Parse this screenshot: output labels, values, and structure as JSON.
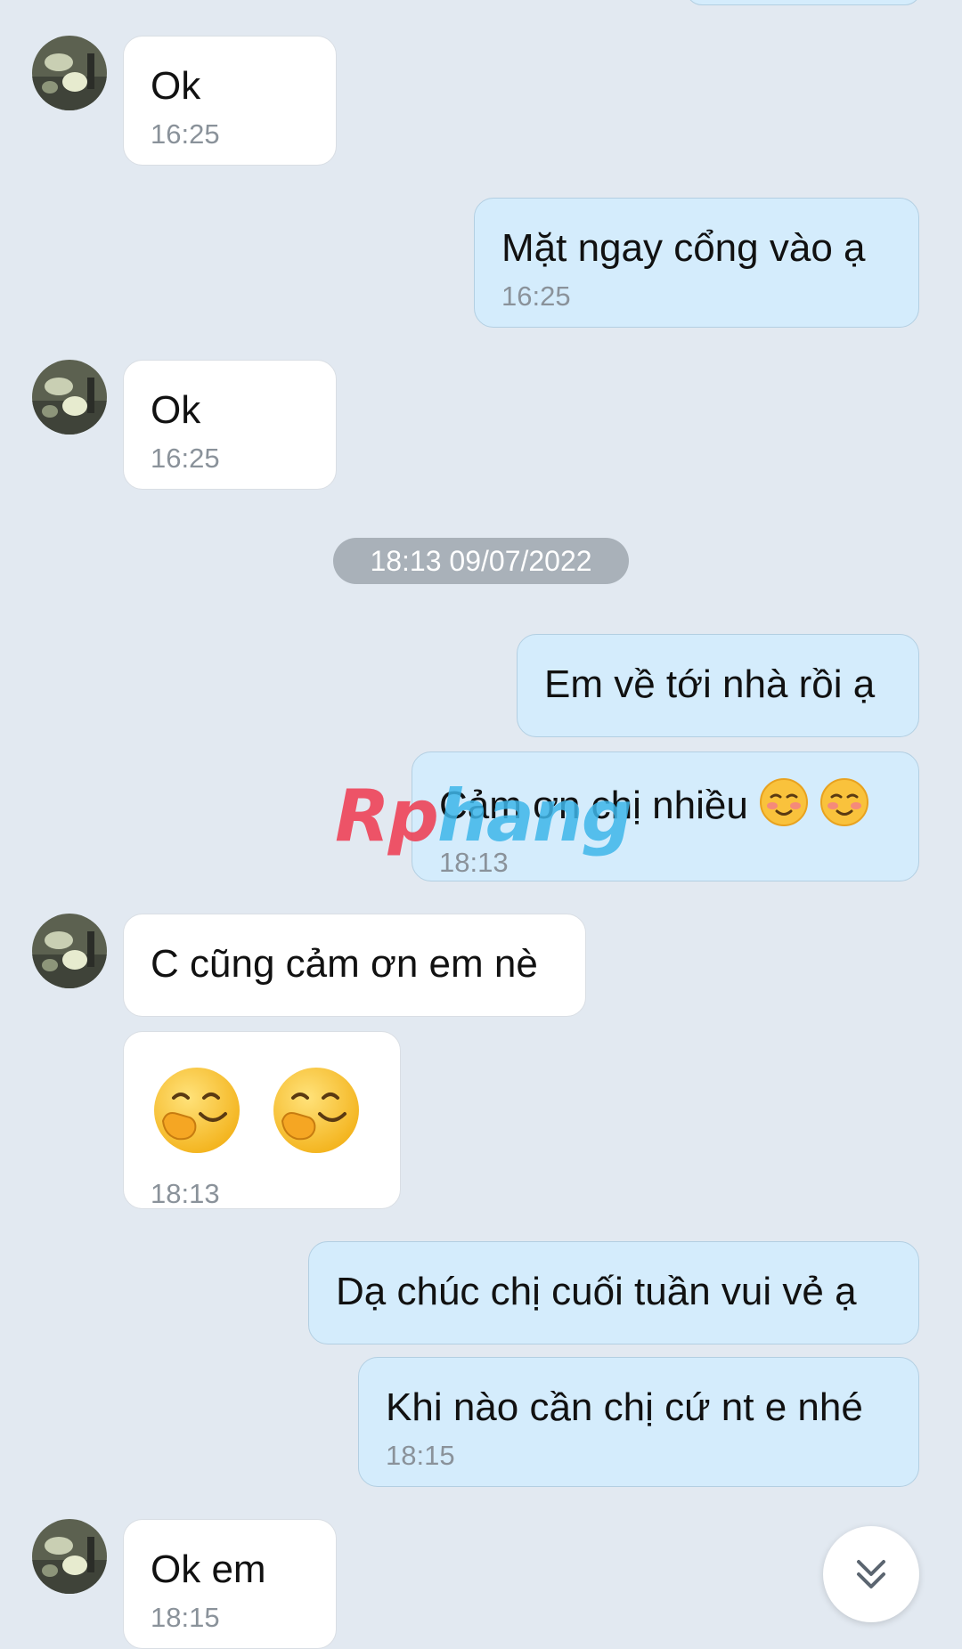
{
  "messages": [
    {
      "side": "in",
      "text": "Ok",
      "time": "16:25"
    },
    {
      "side": "out",
      "text": "Mặt ngay cổng vào ạ",
      "time": "16:25"
    },
    {
      "side": "in",
      "text": "Ok",
      "time": "16:25"
    },
    {
      "side": "out",
      "text": "Em về tới nhà rồi ạ"
    },
    {
      "side": "out",
      "text": "Cảm ơn chị nhiều",
      "time": "18:13",
      "emojis": [
        "smiling-blush-emoji",
        "smiling-blush-emoji"
      ]
    },
    {
      "side": "in",
      "text": "C cũng cảm ơn em nè"
    },
    {
      "side": "in",
      "time": "18:13",
      "emojis": [
        "giggle-emoji",
        "giggle-emoji"
      ]
    },
    {
      "side": "out",
      "text": "Dạ chúc chị cuối tuần vui vẻ ạ"
    },
    {
      "side": "out",
      "text": "Khi nào cần chị cứ nt e nhé",
      "time": "18:15"
    },
    {
      "side": "in",
      "text": "Ok em",
      "time": "18:15"
    }
  ],
  "date_separator": "18:13 09/07/2022",
  "watermark": {
    "part1": "Rp",
    "part2": "hang"
  },
  "scroll_button": {
    "icon": "double-chevron-down-icon"
  },
  "colors": {
    "background": "#e2e9f1",
    "incoming_bubble": "#ffffff",
    "outgoing_bubble": "#d4ecfc",
    "timestamp": "#8a929a",
    "date_pill": "#a9b1b9"
  }
}
